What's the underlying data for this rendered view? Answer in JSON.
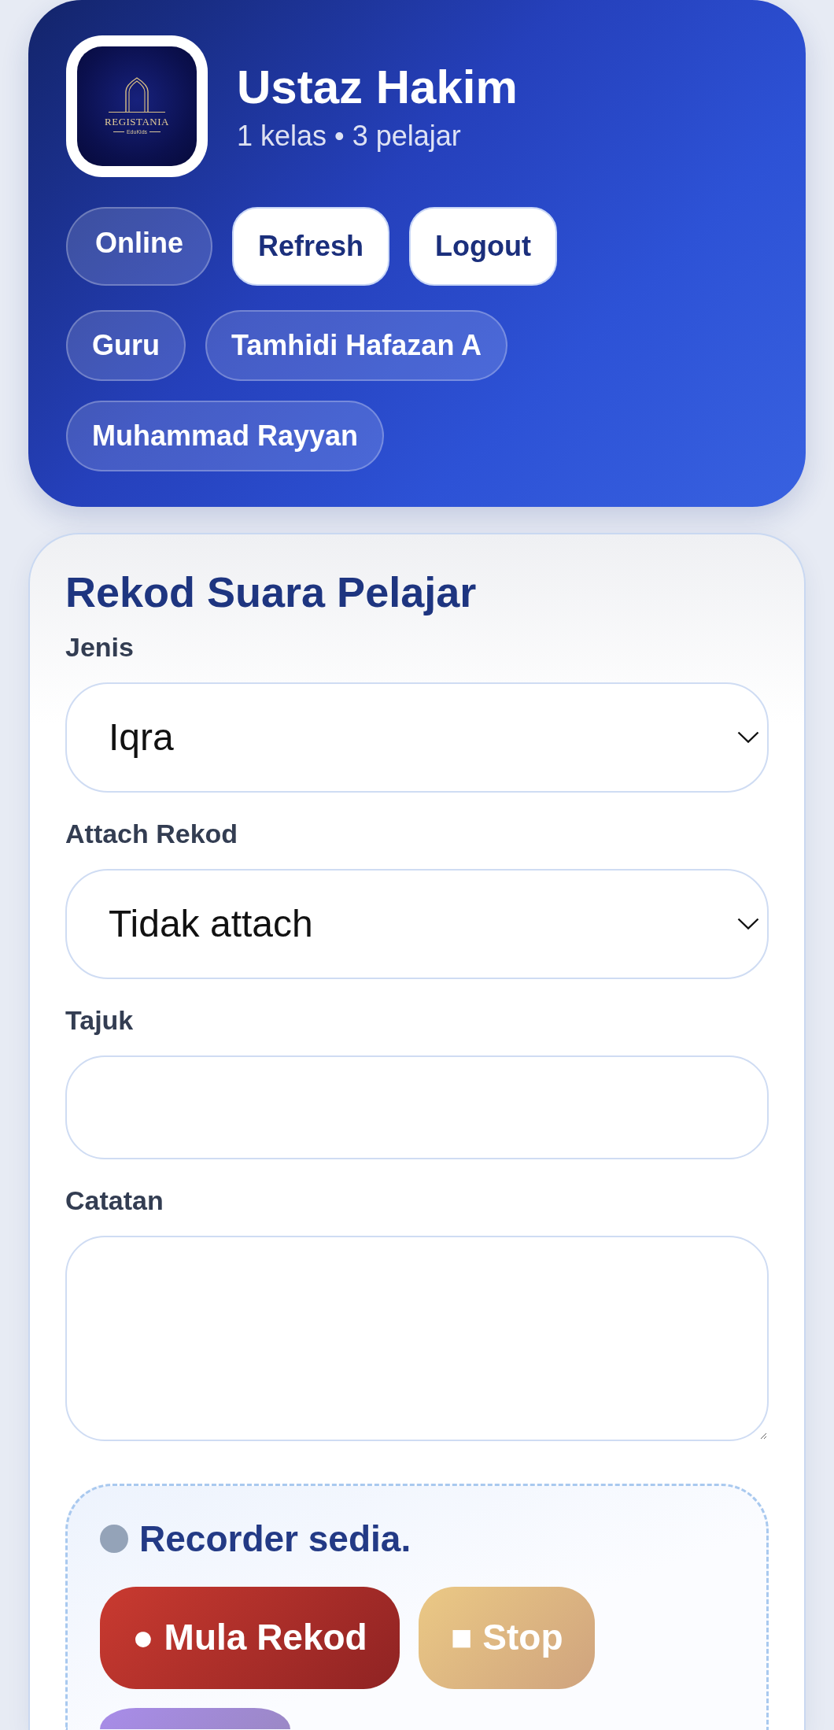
{
  "header": {
    "logo": {
      "name": "REGISTANIA",
      "tagline": "EduKids"
    },
    "title": "Ustaz Hakim",
    "subtitle": "1 kelas • 3 pelajar",
    "actions": [
      {
        "label": "Online",
        "kind": "status"
      },
      {
        "label": "Refresh",
        "kind": "button"
      },
      {
        "label": "Logout",
        "kind": "button"
      }
    ],
    "chips": [
      {
        "label": "Guru"
      },
      {
        "label": "Tamhidi Hafazan A"
      },
      {
        "label": "Muhammad Rayyan"
      }
    ]
  },
  "form": {
    "title": "Rekod Suara Pelajar",
    "fields": [
      {
        "label": "Jenis",
        "kind": "select",
        "value": "Iqra"
      },
      {
        "label": "Attach Rekod",
        "kind": "select",
        "value": "Tidak attach"
      },
      {
        "label": "Tajuk",
        "kind": "text"
      },
      {
        "label": "Catatan",
        "kind": "textarea"
      }
    ],
    "recorder": {
      "status": "Recorder sedia.",
      "recording": false,
      "buttons": [
        {
          "label": "● Mula Rekod",
          "kind": "record"
        },
        {
          "label": "■ Stop",
          "kind": "stop"
        },
        {
          "kind": "other"
        }
      ]
    }
  }
}
